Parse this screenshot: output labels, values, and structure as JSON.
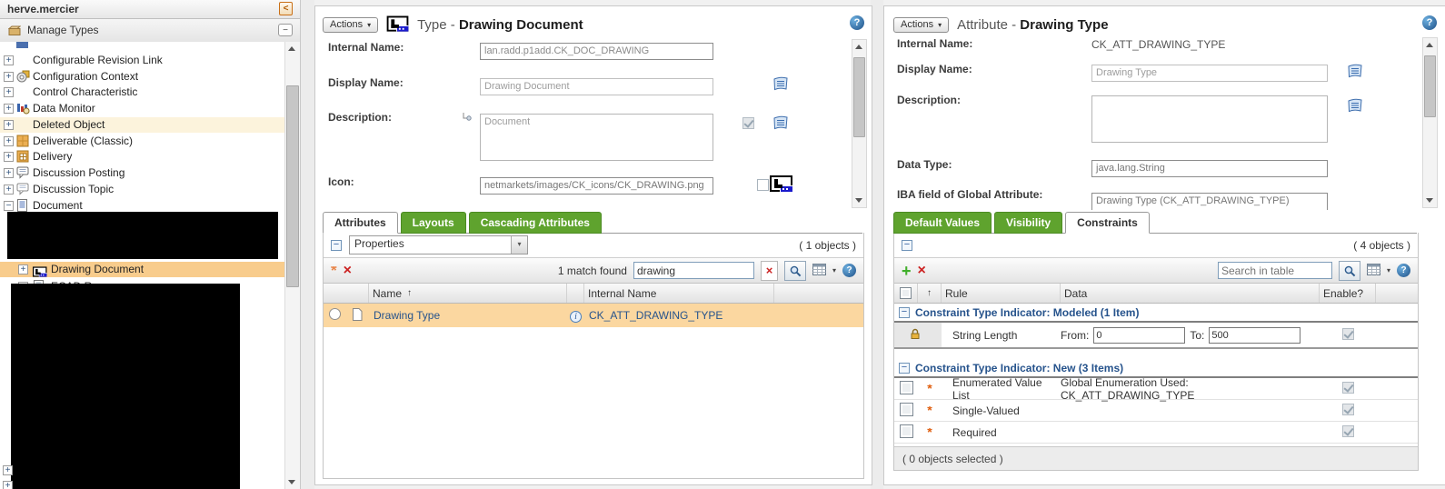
{
  "icons": {
    "caret": "▾",
    "back": "<",
    "minus": "−",
    "plus": "+",
    "help": "?",
    "asterisk": "*",
    "x": "×",
    "add": "+",
    "sort_asc": "↑",
    "info": "i"
  },
  "colors": {
    "tab_green": "#5fa32e",
    "tree_selected": "#f8cc8c",
    "tree_hover": "#fcf3dc",
    "row_selected": "#fbd7a0",
    "navy": "#26538c",
    "redaction": "#000000"
  },
  "window": {
    "title": "herve.mercier"
  },
  "left": {
    "header": "Manage Types",
    "tree": [
      {
        "label": "Configurable Revision Link"
      },
      {
        "label": "Configuration Context"
      },
      {
        "label": "Control Characteristic"
      },
      {
        "label": "Data Monitor"
      },
      {
        "label": "Deleted Object"
      },
      {
        "label": "Deliverable (Classic)"
      },
      {
        "label": "Delivery"
      },
      {
        "label": "Discussion Posting"
      },
      {
        "label": "Discussion Topic"
      },
      {
        "label": "Document"
      },
      {
        "label": "Drawing Document"
      },
      {
        "label": "ECAD R"
      }
    ]
  },
  "middle": {
    "actions_label": "Actions",
    "title_prefix": "Type -",
    "title_name": "Drawing Document",
    "fields": {
      "internal_label": "Internal Name:",
      "internal_value": "lan.radd.p1add.CK_DOC_DRAWING",
      "display_label": "Display Name:",
      "display_value": "Drawing Document",
      "description_label": "Description:",
      "description_value": "Document",
      "icon_label": "Icon:",
      "icon_value": "netmarkets/images/CK_icons/CK_DRAWING.png"
    },
    "tabs": [
      {
        "label": "Attributes"
      },
      {
        "label": "Layouts"
      },
      {
        "label": "Cascading Attributes"
      }
    ],
    "table": {
      "view_selected": "Properties",
      "objects_count": "( 1 objects )",
      "match_text": "1 match found",
      "search_value": "drawing",
      "columns": {
        "name": "Name",
        "internal": "Internal Name"
      },
      "rows": [
        {
          "name": "Drawing Type",
          "internal": "CK_ATT_DRAWING_TYPE"
        }
      ]
    }
  },
  "right": {
    "actions_label": "Actions",
    "title_prefix": "Attribute -",
    "title_name": "Drawing Type",
    "fields": {
      "internal_label": "Internal Name:",
      "internal_value": "CK_ATT_DRAWING_TYPE",
      "display_label": "Display Name:",
      "display_value": "Drawing Type",
      "description_label": "Description:",
      "datatype_label": "Data Type:",
      "datatype_value": "java.lang.String",
      "iba_label": "IBA field of Global Attribute:",
      "iba_value": "Drawing Type (CK_ATT_DRAWING_TYPE)"
    },
    "tabs": [
      {
        "label": "Default Values"
      },
      {
        "label": "Visibility"
      },
      {
        "label": "Constraints"
      }
    ],
    "table": {
      "objects_count": "( 4 objects )",
      "search_placeholder": "Search in table",
      "columns": {
        "sort": "↑",
        "rule": "Rule",
        "data": "Data",
        "enable": "Enable?"
      },
      "group1_header": "Constraint Type Indicator: Modeled (1 Item)",
      "group2_header": "Constraint Type Indicator: New (3 Items)",
      "rows": [
        {
          "rule": "String Length",
          "from_label": "From:",
          "from_value": "0",
          "to_label": "To:",
          "to_value": "500"
        },
        {
          "rule": "Enumerated Value List",
          "data": "Global Enumeration Used: CK_ATT_DRAWING_TYPE"
        },
        {
          "rule": "Single-Valued"
        },
        {
          "rule": "Required"
        }
      ],
      "footer": "( 0 objects selected )"
    }
  }
}
